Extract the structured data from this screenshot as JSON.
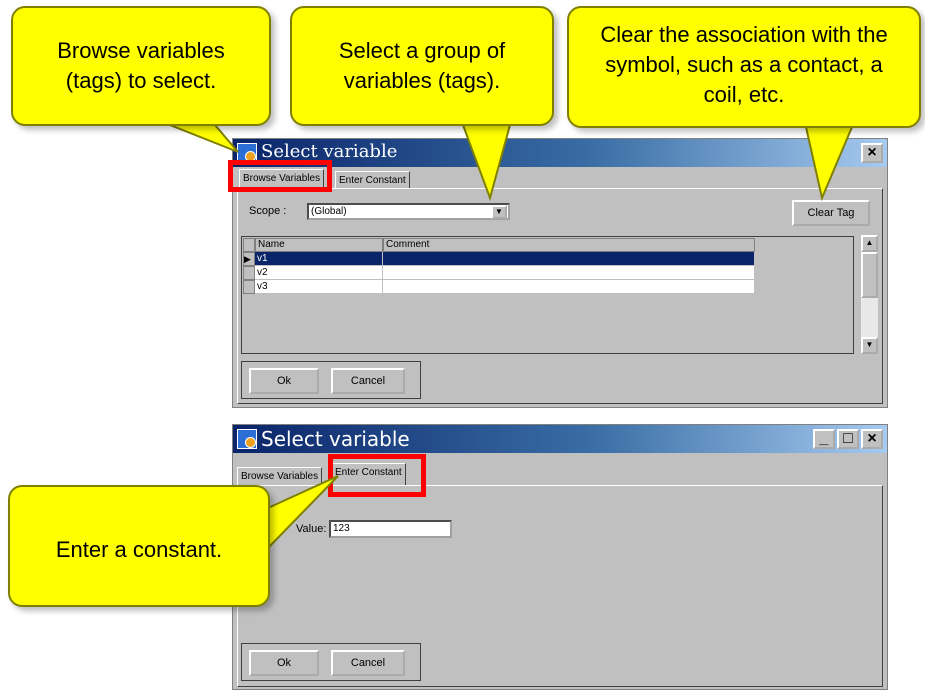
{
  "callouts": {
    "browse": "Browse variables (tags) to select.",
    "group": "Select a group of variables (tags).",
    "clear": "Clear the association with the symbol, such as a contact, a coil, etc.",
    "constant": "Enter a constant."
  },
  "window1": {
    "title": "Select variable",
    "close_glyph": "×",
    "tabs": [
      "Browse Variables",
      "Enter Constant"
    ],
    "scope_label": "Scope :",
    "scope_value": "(Global)",
    "clear_tag_label": "Clear Tag",
    "grid": {
      "columns": [
        "Name",
        "Comment"
      ],
      "rows": [
        {
          "name": "v1",
          "comment": ""
        },
        {
          "name": "v2",
          "comment": ""
        },
        {
          "name": "v3",
          "comment": ""
        }
      ],
      "selected_row": 0
    },
    "ok_label": "Ok",
    "cancel_label": "Cancel"
  },
  "window2": {
    "title": "Select variable",
    "minimize_glyph": "_",
    "maximize_glyph": "□",
    "close_glyph": "×",
    "tabs": [
      "Browse Variables",
      "Enter Constant"
    ],
    "value_label": "Value:",
    "value": "123",
    "ok_label": "Ok",
    "cancel_label": "Cancel"
  },
  "colors": {
    "callout_fill": "#ffff00",
    "highlight": "#ff0000",
    "titlebar": "#0a246a",
    "selection": "#0a246a"
  }
}
